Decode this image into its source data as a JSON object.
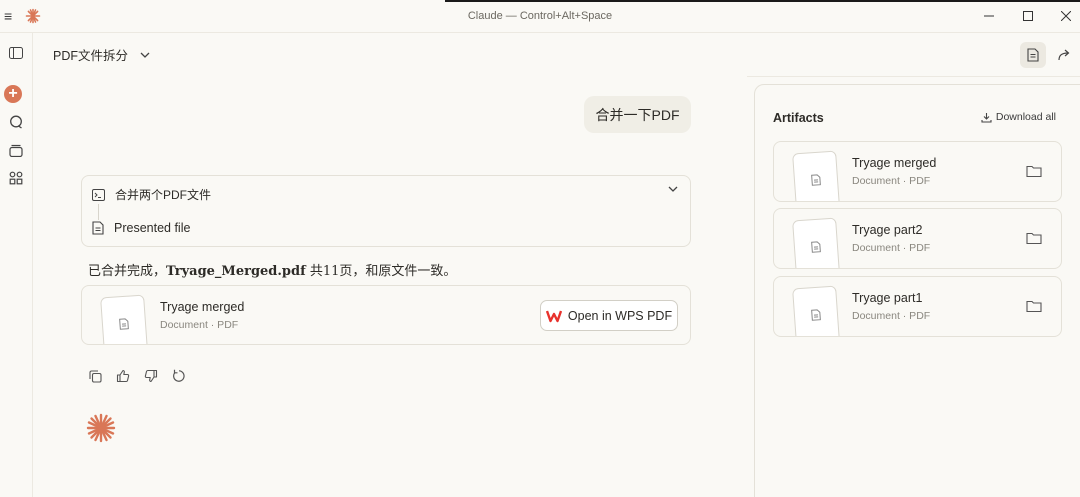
{
  "window": {
    "title": "Claude — Control+Alt+Space"
  },
  "header": {
    "chat_title": "PDF文件拆分"
  },
  "chat": {
    "user_message": "合并一下PDF",
    "tool_call": {
      "label": "合并两个PDF文件",
      "result_label": "Presented file"
    },
    "reply": {
      "prefix": "已合并完成，",
      "filename": "Tryage_Merged.pdf",
      "suffix": " 共11页，和原文件一致。"
    },
    "file_card": {
      "name": "Tryage merged",
      "meta": "Document · PDF",
      "open_button": "Open in WPS PDF"
    }
  },
  "artifacts": {
    "title": "Artifacts",
    "download_all": "Download all",
    "items": [
      {
        "name": "Tryage merged",
        "meta": "Document · PDF"
      },
      {
        "name": "Tryage part2",
        "meta": "Document · PDF"
      },
      {
        "name": "Tryage part1",
        "meta": "Document · PDF"
      }
    ]
  },
  "colors": {
    "accent": "#d97757",
    "background": "#faf9f5",
    "wps_red": "#e8322d"
  },
  "icons": [
    "menu-icon",
    "claude-logo-icon",
    "sidebar-toggle-icon",
    "new-chat-icon",
    "chats-icon",
    "projects-icon",
    "artifacts-icon",
    "chevron-down-icon",
    "document-icon",
    "share-icon",
    "terminal-icon",
    "file-icon",
    "wps-icon",
    "copy-icon",
    "thumbs-up-icon",
    "thumbs-down-icon",
    "retry-icon",
    "download-icon",
    "folder-icon",
    "claude-spark-icon"
  ]
}
